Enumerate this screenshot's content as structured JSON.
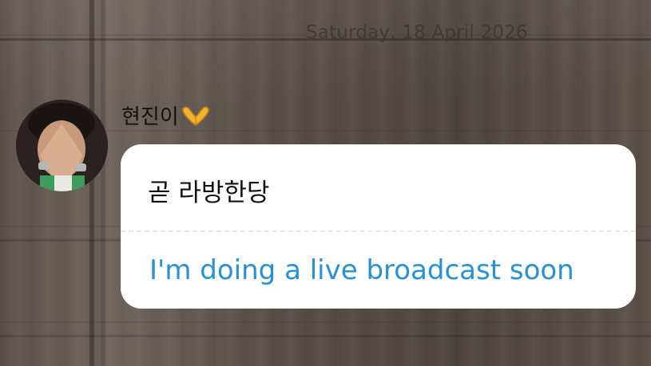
{
  "chat": {
    "date_separator": "Saturday, 18 April 2026",
    "message": {
      "sender_name": "현진이",
      "sender_emoji": "heart-hands-emoji",
      "original_text": "곧 라방한당",
      "translated_text": "I'm doing a live broadcast soon"
    }
  },
  "colors": {
    "translation_text": "#2592d6",
    "bubble_bg": "#ffffff",
    "date_text": "#3d3733"
  }
}
